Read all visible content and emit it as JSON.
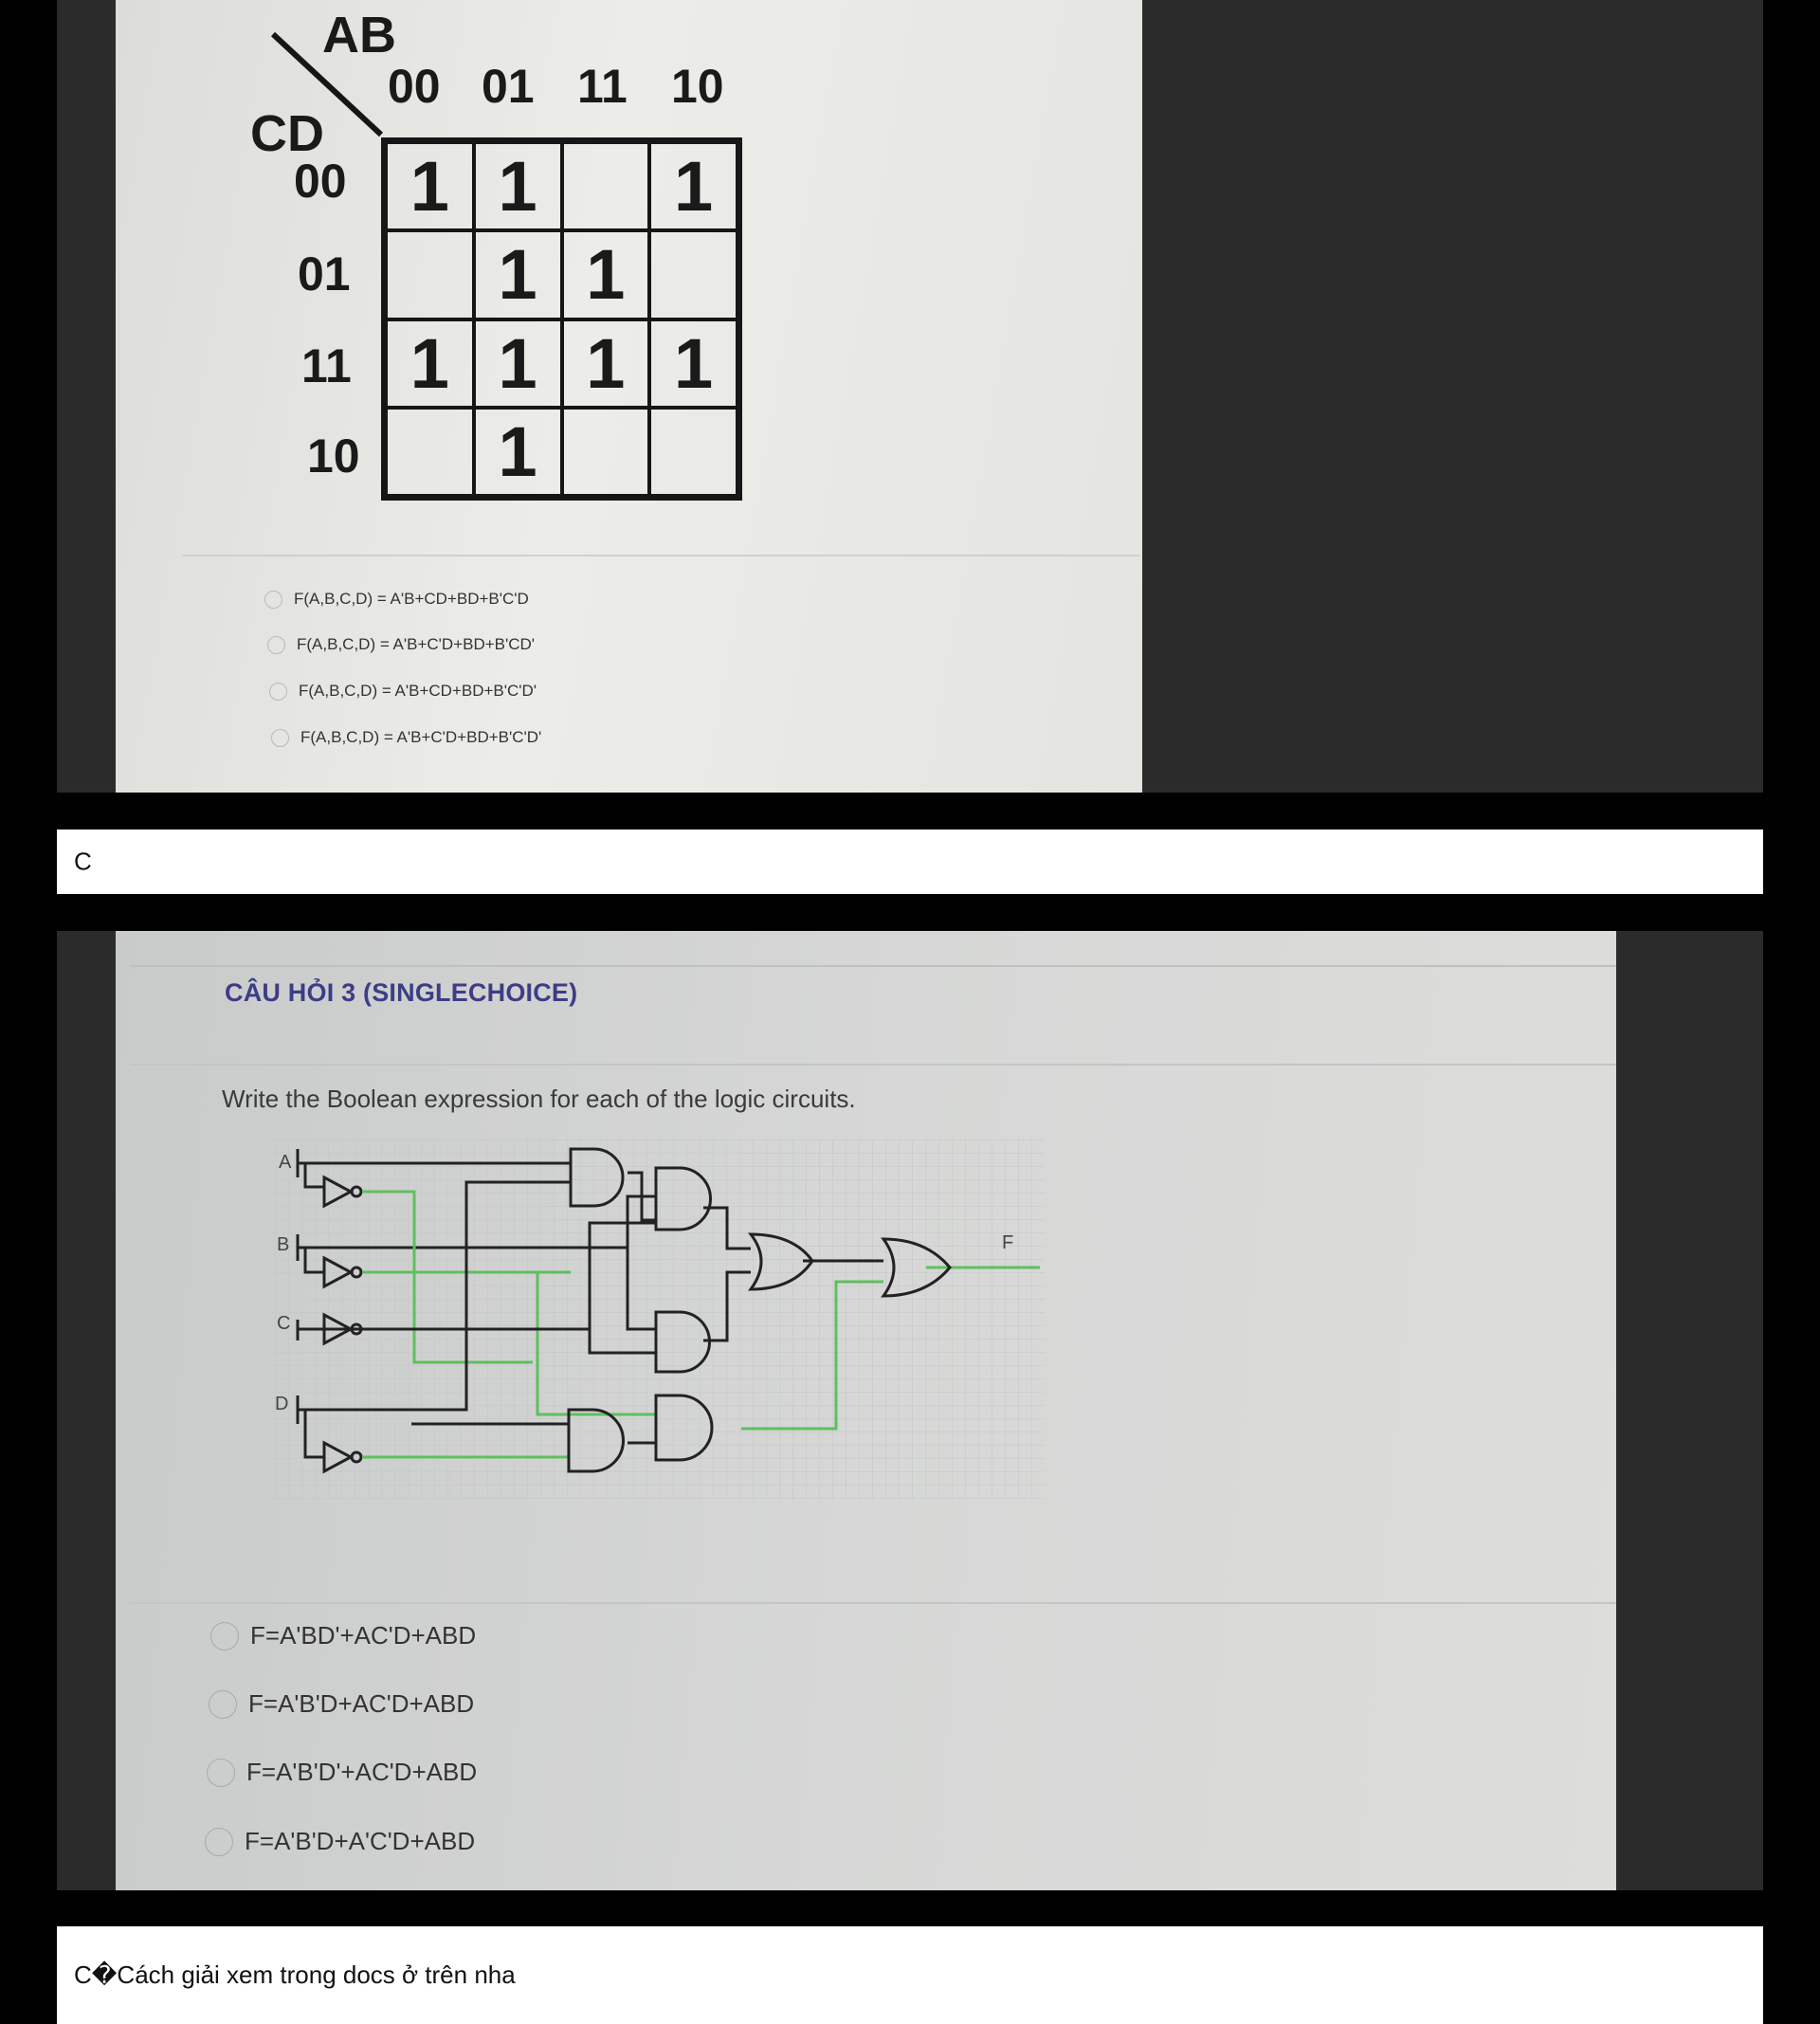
{
  "question1": {
    "kmap": {
      "row_var": "CD",
      "col_var": "AB",
      "col_headers": [
        "00",
        "01",
        "11",
        "10"
      ],
      "row_headers": [
        "00",
        "01",
        "11",
        "10"
      ],
      "cells": [
        [
          "1",
          "1",
          "",
          "1"
        ],
        [
          "",
          "1",
          "1",
          ""
        ],
        [
          "1",
          "1",
          "1",
          "1"
        ],
        [
          "",
          "1",
          "",
          ""
        ]
      ]
    },
    "options": [
      "F(A,B,C,D) = A'B+CD+BD+B'C'D",
      "F(A,B,C,D) = A'B+C'D+BD+B'CD'",
      "F(A,B,C,D) = A'B+CD+BD+B'C'D'",
      "F(A,B,C,D) = A'B+C'D+BD+B'C'D'"
    ]
  },
  "answer1": "C",
  "question2": {
    "title": "CÂU HỎI 3 (SINGLECHOICE)",
    "prompt": "Write the Boolean expression for each of the logic circuits.",
    "circuit": {
      "inputs": [
        "A",
        "B",
        "C",
        "D"
      ],
      "output": "F"
    },
    "options": [
      "F=A'BD'+AC'D+ABD",
      "F=A'B'D+AC'D+ABD",
      "F=A'B'D'+AC'D+ABD",
      "F=A'B'D+A'C'D+ABD"
    ]
  },
  "answer2": "C�Cách giải xem trong docs ở trên nha",
  "colors": {
    "page_background": "#000000",
    "wire_active": "#5fbf5f",
    "wire_inactive": "#222222",
    "title_color": "#3d3d86"
  }
}
